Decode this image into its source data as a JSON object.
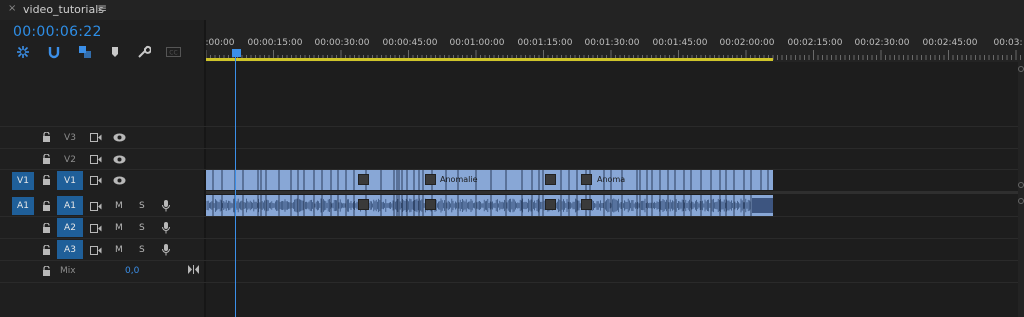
{
  "tab": {
    "title": "video_tutorials",
    "close_glyph": "×",
    "menu_glyph": "≡"
  },
  "timecode": "00:00:06:22",
  "ruler_labels": [
    ":00:00",
    "00:00:15:00",
    "00:00:30:00",
    "00:00:45:00",
    "00:01:00:00",
    "00:01:15:00",
    "00:01:30:00",
    "00:01:45:00",
    "00:02:00:00",
    "00:02:15:00",
    "00:02:30:00",
    "00:02:45:00",
    "00:03:"
  ],
  "video_tracks": [
    {
      "name": "V3",
      "source": "",
      "target_on": false
    },
    {
      "name": "V2",
      "source": "",
      "target_on": false
    },
    {
      "name": "V1",
      "source": "V1",
      "target_on": true
    }
  ],
  "audio_tracks": [
    {
      "name": "A1",
      "source": "A1",
      "target_on": true,
      "m": "M",
      "s": "S"
    },
    {
      "name": "A2",
      "source": "",
      "target_on": true,
      "m": "M",
      "s": "S"
    },
    {
      "name": "A3",
      "source": "",
      "target_on": true,
      "m": "M",
      "s": "S"
    }
  ],
  "mix": {
    "label": "Mix",
    "value": "0,0"
  },
  "clips": {
    "v1_label_1": "Anomalie",
    "v1_label_2": "Anoma"
  },
  "colors": {
    "accent": "#2e8ee6",
    "clip": "#88a7d6",
    "workarea": "#cfc52a",
    "target": "#1f5f99"
  }
}
